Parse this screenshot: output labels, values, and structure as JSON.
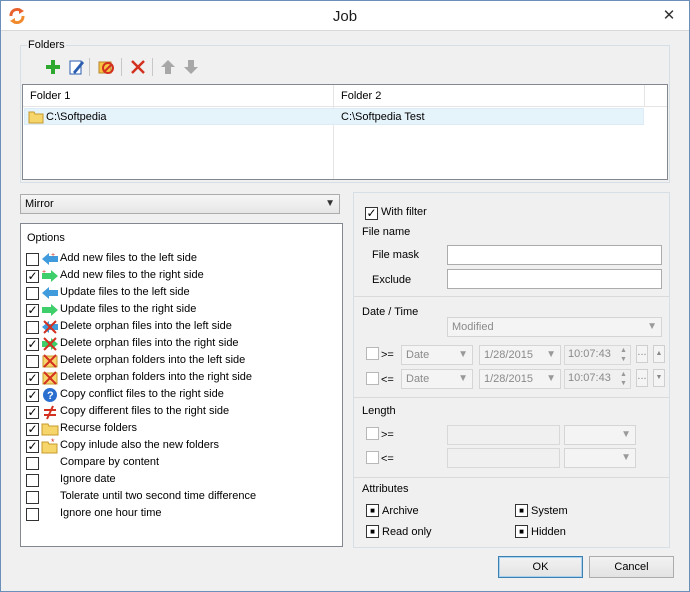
{
  "window": {
    "title": "Job",
    "close_glyph": "✕"
  },
  "folders": {
    "group_title": "Folders",
    "toolbar": [
      "add-icon",
      "edit-icon",
      "remove-all-icon",
      "delete-icon",
      "move-up-icon",
      "move-down-icon"
    ],
    "columns": [
      "Folder 1",
      "Folder 2"
    ],
    "rows": [
      {
        "folder1": "C:\\Softpedia",
        "folder2": "C:\\Softpedia Test"
      }
    ]
  },
  "mode": {
    "selected": "Mirror"
  },
  "options": {
    "title": "Options",
    "items": [
      {
        "label": "Add new files to the left side",
        "checked": false,
        "icon": "arrow-left-add-icon"
      },
      {
        "label": "Add new files to the right side",
        "checked": true,
        "icon": "arrow-right-add-icon"
      },
      {
        "label": "Update files to the left side",
        "checked": false,
        "icon": "arrow-left-icon"
      },
      {
        "label": "Update files to the right side",
        "checked": true,
        "icon": "arrow-right-icon"
      },
      {
        "label": "Delete orphan files into the left side",
        "checked": false,
        "icon": "delete-orphan-left-icon"
      },
      {
        "label": "Delete orphan files into the right side",
        "checked": true,
        "icon": "delete-orphan-right-icon"
      },
      {
        "label": "Delete orphan folders into the left side",
        "checked": false,
        "icon": "delete-folder-left-icon"
      },
      {
        "label": "Delete orphan folders into the right side",
        "checked": true,
        "icon": "delete-folder-right-icon"
      },
      {
        "label": "Copy conflict files to the right side",
        "checked": true,
        "icon": "conflict-icon"
      },
      {
        "label": "Copy different files to the right side",
        "checked": true,
        "icon": "not-equal-icon"
      },
      {
        "label": "Recurse folders",
        "checked": true,
        "icon": "folder-icon"
      },
      {
        "label": "Copy inlude also the new folders",
        "checked": true,
        "icon": "new-folder-icon"
      },
      {
        "label": "Compare by content",
        "checked": false,
        "icon": ""
      },
      {
        "label": "Ignore date",
        "checked": false,
        "icon": ""
      },
      {
        "label": "Tolerate until two second time difference",
        "checked": false,
        "icon": ""
      },
      {
        "label": "Ignore one hour time",
        "checked": false,
        "icon": ""
      }
    ]
  },
  "filter": {
    "with_filter_label": "With filter",
    "with_filter_checked": true,
    "file_name": {
      "title": "File name",
      "mask_label": "File mask",
      "mask_value": "",
      "exclude_label": "Exclude",
      "exclude_value": ""
    },
    "date_time": {
      "title": "Date / Time",
      "mode": "Modified",
      "rows": [
        {
          "op": ">=",
          "type": "Date",
          "date": "1/28/2015",
          "time": "10:07:43",
          "checked": false
        },
        {
          "op": "<=",
          "type": "Date",
          "date": "1/28/2015",
          "time": "10:07:43",
          "checked": false
        }
      ],
      "dots": "...",
      "scroll_up": "▲",
      "scroll_down": "▼"
    },
    "length": {
      "title": "Length",
      "rows": [
        {
          "op": ">=",
          "value": "",
          "unit": ""
        },
        {
          "op": "<=",
          "value": "",
          "unit": ""
        }
      ]
    },
    "attributes": {
      "title": "Attributes",
      "items": [
        {
          "label": "Archive",
          "state": "indeterminate"
        },
        {
          "label": "System",
          "state": "indeterminate"
        },
        {
          "label": "Read only",
          "state": "indeterminate"
        },
        {
          "label": "Hidden",
          "state": "indeterminate"
        }
      ]
    }
  },
  "buttons": {
    "ok": "OK",
    "cancel": "Cancel"
  },
  "colors": {
    "accent": "#3c7fb1",
    "selection": "#e5f3fb"
  }
}
